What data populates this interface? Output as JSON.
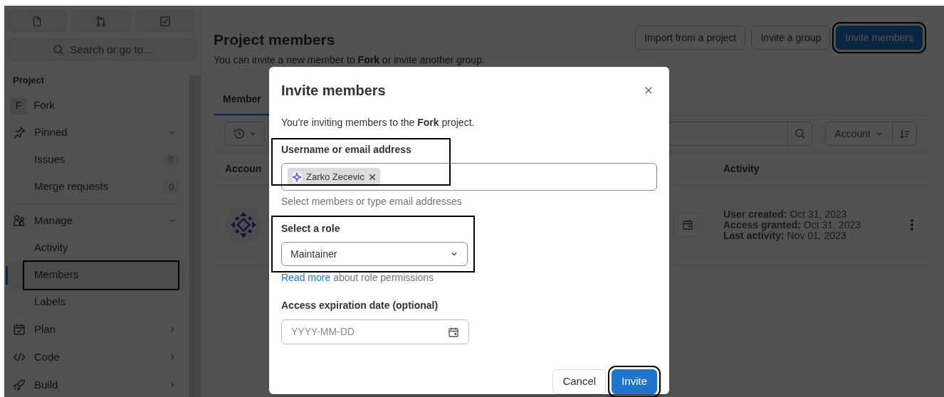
{
  "sidebar": {
    "search": {
      "placeholder": "Search or go to..."
    },
    "section_label": "Project",
    "project": {
      "initial": "F",
      "name": "Fork"
    },
    "items": [
      {
        "label": "Pinned",
        "expanded": true,
        "children": [
          {
            "label": "Issues",
            "count": "0",
            "selected": false
          },
          {
            "label": "Merge requests",
            "count": "0",
            "selected": false
          }
        ]
      },
      {
        "label": "Manage",
        "expanded": true,
        "children": [
          {
            "label": "Activity",
            "selected": false
          },
          {
            "label": "Members",
            "selected": true,
            "highlighted": true
          },
          {
            "label": "Labels",
            "selected": false
          }
        ]
      },
      {
        "label": "Plan",
        "expanded": false
      },
      {
        "label": "Code",
        "expanded": false
      },
      {
        "label": "Build",
        "expanded": false
      }
    ]
  },
  "header": {
    "title": "Project members",
    "description": "You can invite a new member to **Fork** or invite another group.",
    "buttons": [
      {
        "label": "Import from a project",
        "kind": "secondary",
        "highlighted": false
      },
      {
        "label": "Invite a group",
        "kind": "secondary",
        "highlighted": false
      },
      {
        "label": "Invite members",
        "kind": "primary",
        "highlighted": true
      }
    ]
  },
  "tabs": [
    {
      "label": "Member",
      "selected": true
    }
  ],
  "filter": {
    "sort": "Account"
  },
  "table": {
    "columns": [
      "Accoun",
      "Activity"
    ],
    "rows": [
      {
        "activity": [
          "**User created:** Oct 31, 2023",
          "**Access granted:** Oct 31, 2023",
          "**Last activity:** Nov 01, 2023"
        ]
      }
    ]
  },
  "modal": {
    "title": "Invite members",
    "intro": "You're inviting members to the **Fork** project.",
    "username": {
      "label": "Username or email address",
      "highlighted": true,
      "tokens": [
        {
          "label": "Zarko Zecevic"
        }
      ],
      "help": "Select members or type email addresses"
    },
    "role": {
      "label": "Select a role",
      "highlighted": true,
      "value": "Maintainer",
      "link": "Read more",
      "help": "about role permissions"
    },
    "expiration": {
      "label": "Access expiration date (optional)",
      "placeholder": "YYYY-MM-DD"
    },
    "buttons": [
      {
        "label": "Cancel",
        "kind": "secondary",
        "highlighted": false
      },
      {
        "label": "Invite",
        "kind": "primary",
        "highlighted": true
      }
    ]
  }
}
